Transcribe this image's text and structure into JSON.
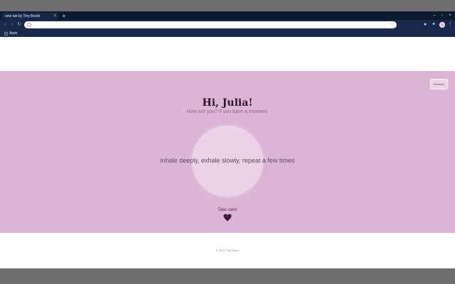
{
  "browser": {
    "tab_title": "new tab by Tiny Brook",
    "tab_close": "×",
    "new_tab": "+",
    "bookmarks_label": "Apps",
    "window_controls": [
      "–",
      "▫",
      "×"
    ]
  },
  "page": {
    "session_button": "sessions",
    "greeting": "Hi, Julia!",
    "subtitle": "How are you? If you have a moment,",
    "instruction": "inhale deeply, exhale slowly, repeat a few times",
    "closing": "Take care!",
    "footer": "© 2020 Tiny Brook"
  },
  "colors": {
    "hero_bg": "#dcb4d4",
    "browser_chrome": "#16294a",
    "breath_circle": "#ecd2e8",
    "heart": "#2a1f2e"
  }
}
